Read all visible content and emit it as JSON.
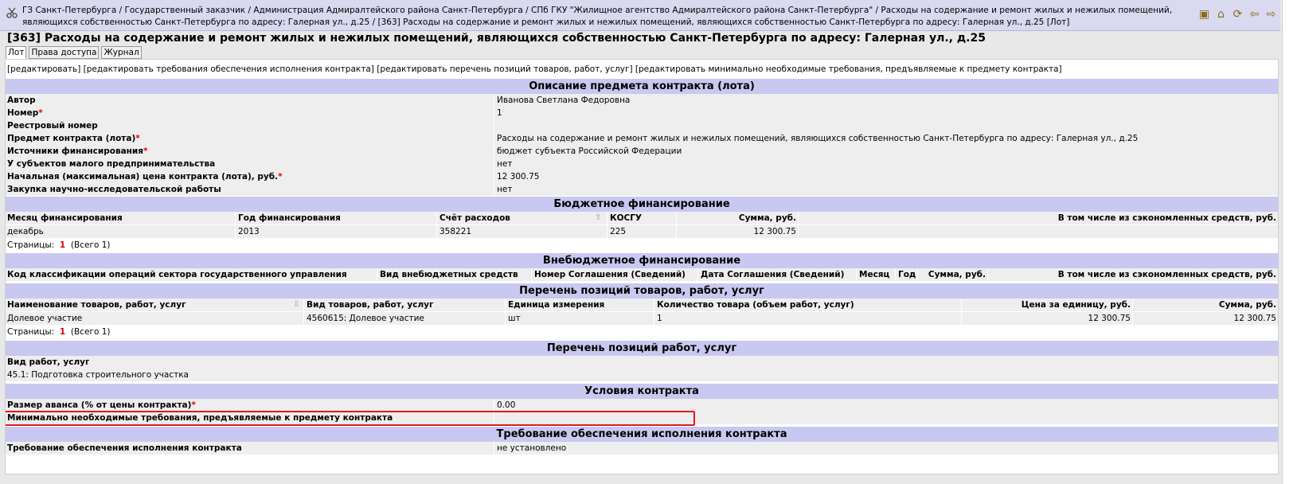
{
  "breadcrumb": {
    "items": [
      "ГЗ Санкт-Петербурга",
      "Государственный заказчик",
      "Администрация Адмиралтейского района Санкт-Петербурга",
      "СПб ГКУ \"Жилищное агентство Адмиралтейского района Санкт-Петербурга\"",
      "Расходы на содержание и ремонт жилых и нежилых помещений, являющихся собственностью Санкт-Петербурга по адресу: Галерная ул., д.25",
      "[363] Расходы на содержание и ремонт жилых и нежилых помещений, являющихся собственностью Санкт-Петербурга по адресу: Галерная ул., д.25 [Лот]"
    ],
    "separator": " / "
  },
  "toolbar": {
    "icons": [
      "catalog-icon",
      "home-icon",
      "refresh-icon",
      "back-arrow-icon",
      "forward-arrow-icon"
    ],
    "glyphs": [
      "▣",
      "⌂",
      "⟳",
      "⇦",
      "⇨"
    ]
  },
  "page_title": "[363] Расходы на содержание и ремонт жилых и нежилых помещений, являющихся собственностью Санкт-Петербурга по адресу: Галерная ул., д.25",
  "tabs": [
    "Лот",
    "Права доступа",
    "Журнал"
  ],
  "actions": [
    "[редактировать]",
    "[редактировать требования обеспечения исполнения контракта]",
    "[редактировать перечень позиций товаров, работ, услуг]",
    "[редактировать минимально необходимые требования, предъявляемые к предмету контракта]"
  ],
  "description": {
    "title": "Описание предмета контракта (лота)",
    "rows": [
      {
        "label": "Автор",
        "required": false,
        "value": "Иванова Светлана Федоровна"
      },
      {
        "label": "Номер",
        "required": true,
        "value": "1"
      },
      {
        "label": "Реестровый номер",
        "required": false,
        "value": ""
      },
      {
        "label": "Предмет контракта (лота)",
        "required": true,
        "value": "Расходы на содержание и ремонт жилых и нежилых помещений, являющихся собственностью Санкт-Петербурга по адресу: Галерная ул., д.25"
      },
      {
        "label": "Источники финансирования",
        "required": true,
        "value": "бюджет субъекта Российской Федерации"
      },
      {
        "label": "У субъектов малого предпринимательства",
        "required": false,
        "value": "нет"
      },
      {
        "label": "Начальная (максимальная) цена контракта (лота), руб.",
        "required": true,
        "value": "12 300.75"
      },
      {
        "label": "Закупка научно-исследовательской работы",
        "required": false,
        "value": "нет"
      }
    ]
  },
  "budget": {
    "title": "Бюджетное финансирование",
    "headers": [
      "Месяц финансирования",
      "Год финансирования",
      "Счёт расходов",
      "КОСГУ",
      "Сумма, руб.",
      "В том числе из сэкономленных средств, руб."
    ],
    "rows": [
      [
        "декабрь",
        "2013",
        "358221",
        "225",
        "12 300.75",
        ""
      ]
    ],
    "pages_label": "Страницы:",
    "page": "1",
    "total": "(Всего 1)"
  },
  "offbudget": {
    "title": "Внебюджетное финансирование",
    "headers": [
      "Код классификации операций сектора государственного управления",
      "Вид внебюджетных средств",
      "Номер Соглашения (Сведений)",
      "Дата Соглашения (Сведений)",
      "Месяц",
      "Год",
      "Сумма, руб.",
      "В том числе из сэкономленных средств, руб."
    ]
  },
  "goods": {
    "title": "Перечень позиций товаров, работ, услуг",
    "headers": [
      "Наименование товаров, работ, услуг",
      "Вид товаров, работ, услуг",
      "Единица измерения",
      "Количество товара (объем работ, услуг)",
      "Цена за единицу, руб.",
      "Сумма, руб."
    ],
    "rows": [
      [
        "Долевое участие",
        "4560615: Долевое участие",
        "шт",
        "1",
        "12 300.75",
        "12 300.75"
      ]
    ],
    "pages_label": "Страницы:",
    "page": "1",
    "total": "(Всего 1)"
  },
  "works": {
    "title": "Перечень позиций работ, услуг",
    "header": "Вид работ, услуг",
    "value": "45.1: Подготовка строительного участка"
  },
  "conditions": {
    "title": "Условия контракта",
    "rows": [
      {
        "label": "Размер аванса (% от цены контракта)",
        "required": true,
        "value": "0.00"
      },
      {
        "label": "Минимально необходимые требования, предъявляемые к предмету контракта",
        "required": false,
        "value": ""
      }
    ]
  },
  "security": {
    "title": "Требование обеспечения исполнения контракта",
    "rows": [
      {
        "label": "Требование обеспечения исполнения контракта",
        "required": false,
        "value": "не установлено"
      }
    ]
  },
  "colors": {
    "section_header": "#c8c8f0",
    "row_gray": "#eeeeee",
    "required": "#dd0000",
    "highlight": "#e21b1b"
  }
}
